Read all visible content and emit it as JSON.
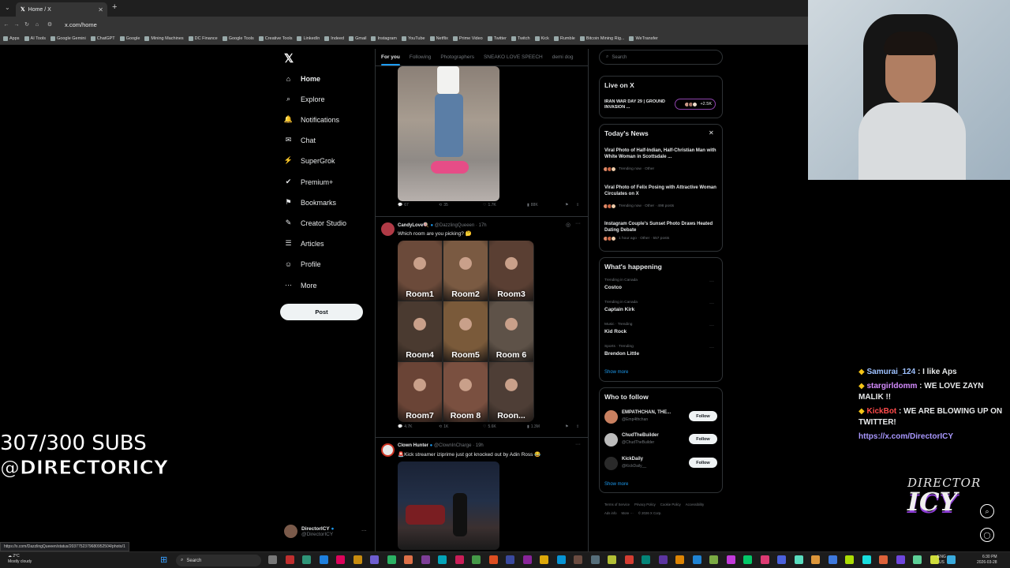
{
  "browser": {
    "tab_title": "Home / X",
    "url": "x.com/home",
    "bookmarks": [
      "Apps",
      "AI Tools",
      "Google Gemini",
      "ChatGPT",
      "Google",
      "Mining Machines",
      "DC Finance",
      "Google Tools",
      "Creative Tools",
      "LinkedIn",
      "Indeed",
      "Gmail",
      "Instagram",
      "YouTube",
      "Netflix",
      "Prime Video",
      "Twitter",
      "Twitch",
      "Kick",
      "Rumble",
      "Bitcoin Mining Rig...",
      "WeTransfer"
    ]
  },
  "nav": {
    "items": [
      "Home",
      "Explore",
      "Notifications",
      "Chat",
      "SuperGrok",
      "Premium+",
      "Bookmarks",
      "Creator Studio",
      "Articles",
      "Profile",
      "More"
    ],
    "post_label": "Post",
    "account_name": "DirectorICY",
    "account_handle": "@DirectorICY"
  },
  "feed": {
    "tabs": [
      "For you",
      "Following",
      "Photographers",
      "SNEAKO LOVE SPEECH",
      "demi dog"
    ],
    "post1": {
      "stats": [
        "67",
        "35",
        "1.7K",
        "88K"
      ]
    },
    "post2": {
      "name": "CandyLove🍭",
      "handle": "@DazzlingQueeen · 17h",
      "text": "Which room are you picking? 🤔",
      "rooms": [
        "Room1",
        "Room2",
        "Room3",
        "Room4",
        "Room5",
        "Room 6",
        "Room7",
        "Room 8",
        "Roon..."
      ],
      "stats": [
        "4.7K",
        "1K",
        "5.6K",
        "1.3M"
      ]
    },
    "post3": {
      "name": "Clown Hunter",
      "handle": "@ClownInCharge · 19h",
      "text": "🚨Kick streamer iziprime just got knocked out by Adin Ross 😂"
    }
  },
  "sidebar": {
    "search_placeholder": "Search",
    "live": {
      "title": "Live on X",
      "item": "IRAN WAR DAY 29 | GROUND INVASION ...",
      "count": "+2.5K"
    },
    "news": {
      "title": "Today's News",
      "items": [
        {
          "headline": "Viral Photo of Half-Indian, Half-Christian Man with White Woman in Scottsdale ...",
          "meta": "Trending now · Other"
        },
        {
          "headline": "Viral Photo of Felix Posing with Attractive Woman Circulates on X",
          "meta": "Trending now · Other · 498 posts"
        },
        {
          "headline": "Instagram Couple's Sunset Photo Draws Heated Dating Debate",
          "meta": "1 hour ago · Other · 557 posts"
        }
      ]
    },
    "happening": {
      "title": "What's happening",
      "items": [
        {
          "context": "Trending in Canada",
          "topic": "Costco"
        },
        {
          "context": "Trending in Canada",
          "topic": "Captain Kirk"
        },
        {
          "context": "Music · Trending",
          "topic": "Kid Rock"
        },
        {
          "context": "Sports · Trending",
          "topic": "Brendon Little"
        }
      ],
      "show_more": "Show more"
    },
    "follow": {
      "title": "Who to follow",
      "items": [
        {
          "name": "EMPATHCHAN, THE...",
          "handle": "@Emp4thchan"
        },
        {
          "name": "ChudTheBuilder",
          "handle": "@ChudTheBuilder"
        },
        {
          "name": "KickDaily",
          "handle": "@KickDaily__"
        }
      ],
      "button": "Follow",
      "show_more": "Show more"
    },
    "footer": [
      "Terms of Service",
      "Privacy Policy",
      "Cookie Policy",
      "Accessibility",
      "Ads info",
      "More ···",
      "© 2026 X Corp."
    ]
  },
  "overlay": {
    "subs_count": "307/300 SUBS",
    "subs_handle": "@DIRECTORICY",
    "chat": [
      {
        "user": "Samurai_124",
        "msg": "I like Aps",
        "color": "#9ec1ff"
      },
      {
        "user": "stargirldomm",
        "msg": "WE LOVE ZAYN MALIK !!",
        "color": "#d58cff"
      },
      {
        "user": "KickBot",
        "msg": "WE ARE BLOWING UP ON TWITTER!",
        "color": "#ff4b4b"
      }
    ],
    "chat_link": "https://x.com/DirectorICY",
    "brand_top": "DIRECTOR",
    "brand_bottom": "ICY"
  },
  "statusbar": {
    "url": "https://x.com/DazzlingQueeen/status/2037752379680952504/photo/1"
  },
  "taskbar": {
    "weather_temp": "2°C",
    "weather_text": "Mostly cloudy",
    "search": "Search",
    "lang": "ENG",
    "region": "US",
    "time": "6:30 PM",
    "date": "2026-03-28"
  }
}
